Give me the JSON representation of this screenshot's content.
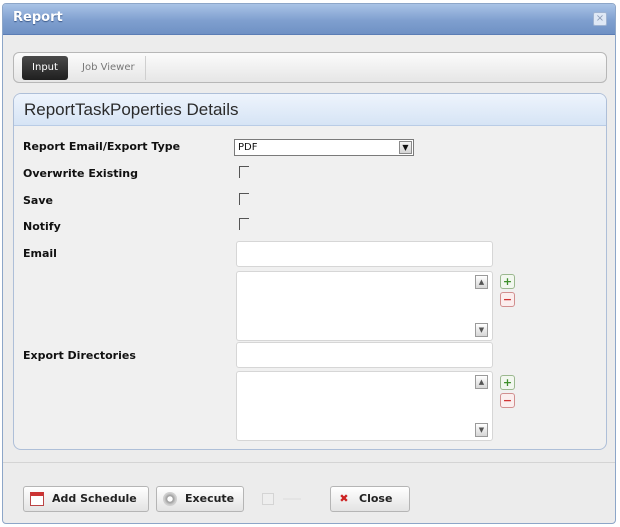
{
  "window": {
    "title": "Report",
    "close_glyph": "×"
  },
  "tabs": [
    {
      "label": "Input",
      "active": true
    },
    {
      "label": "Job Viewer",
      "active": false
    }
  ],
  "panel": {
    "title": "ReportTaskPoperties Details"
  },
  "form": {
    "export_type": {
      "label": "Report Email/Export Type",
      "value": "PDF"
    },
    "overwrite_existing": {
      "label": "Overwrite Existing",
      "checked": false
    },
    "save": {
      "label": "Save",
      "checked": false
    },
    "notify": {
      "label": "Notify",
      "checked": false
    },
    "email": {
      "label": "Email",
      "value": "",
      "list": []
    },
    "export_directories": {
      "label": "Export Directories",
      "value": "",
      "list": []
    }
  },
  "list_controls": {
    "add_glyph": "+",
    "remove_glyph": "−"
  },
  "footer": {
    "add_schedule_label": "Add Schedule",
    "execute_label": "Execute",
    "close_label": "Close"
  },
  "icons": {
    "title_close": "close-icon",
    "add_schedule": "calendar-icon",
    "execute": "gear-icon",
    "close": "x-icon"
  },
  "colors": {
    "titlebar": "#7f9fcf",
    "active_tab": "#2a2a2a",
    "panel_header": "#d6e4f5",
    "add": "#3d8f2a",
    "remove": "#d03434"
  }
}
